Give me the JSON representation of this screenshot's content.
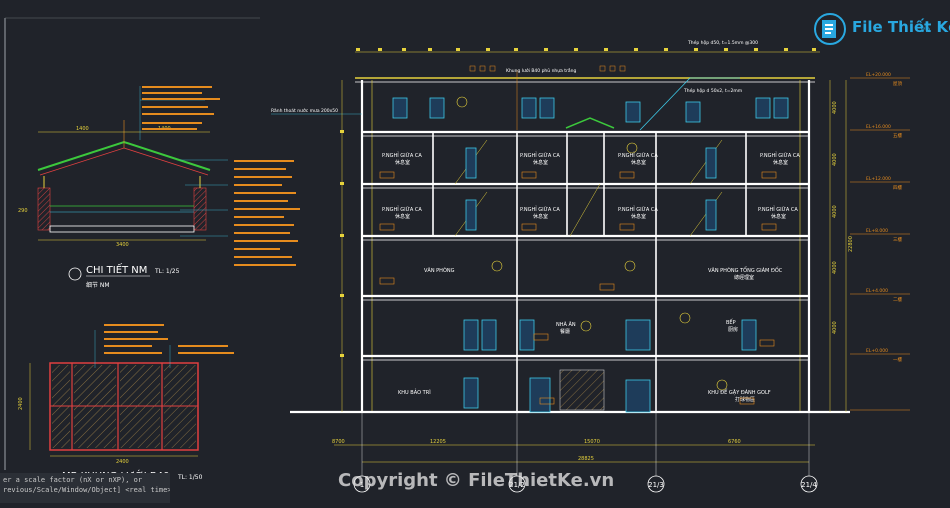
{
  "detail_nm": {
    "title": "CHI TIẾT NM",
    "scale": "TL: 1/25",
    "subtitle_cn": "细节 NM",
    "dim_left": "1400",
    "dim_right": "1400",
    "dim_bottom": "3400",
    "dim_height": "290"
  },
  "khung": {
    "title": "MB KHUNG LƯỚI B40",
    "scale": "TL: 1/50",
    "dim_width": "2400",
    "dim_height": "2400"
  },
  "section": {
    "rooms": [
      {
        "id": "r1",
        "label": "P.NGHỈ GIỮA CA",
        "cn": "休息室"
      },
      {
        "id": "r2",
        "label": "P.NGHỈ GIỮA CA",
        "cn": "休息室"
      },
      {
        "id": "r3",
        "label": "P.NGHỈ GIỮA CA",
        "cn": "休息室"
      },
      {
        "id": "r4",
        "label": "P.NGHỈ GIỮA CA",
        "cn": "休息室"
      },
      {
        "id": "r5",
        "label": "P.NGHỈ GIỮA CA",
        "cn": "休息室"
      },
      {
        "id": "r6",
        "label": "P.NGHỈ GIỮA CA",
        "cn": "休息室"
      },
      {
        "id": "r7",
        "label": "P.NGHỈ GIỮA CA",
        "cn": "休息室"
      },
      {
        "id": "r8",
        "label": "P.NGHỈ GIỮA CA",
        "cn": "休息室"
      },
      {
        "id": "vp",
        "label": "VĂN PHÒNG",
        "cn": ""
      },
      {
        "id": "vptgd",
        "label": "VĂN PHÒNG TỔNG GIÁM ĐỐC",
        "cn": "總經理室"
      },
      {
        "id": "na",
        "label": "NHÀ ĂN",
        "cn": "餐廳"
      },
      {
        "id": "bep",
        "label": "BẾP",
        "cn": "厨房"
      },
      {
        "id": "kbt",
        "label": "KHU BẢO TRÌ",
        "cn": ""
      },
      {
        "id": "golf",
        "label": "KHU ĐỂ GẬY ĐÁNH GOLF",
        "cn": "打球物區"
      }
    ],
    "level_labels": [
      "EL+20.000",
      "EL+16.000",
      "EL+12.000",
      "EL+8.000",
      "EL+4.000",
      "EL+0.000"
    ],
    "floor_labels": [
      "屋頂",
      "五樓",
      "四樓",
      "三樓",
      "二樓",
      "一樓"
    ],
    "dims_right": [
      "4000",
      "4000",
      "4000",
      "4000",
      "4000",
      "22800"
    ],
    "dims_bottom": [
      "8700",
      "12205",
      "15070",
      "6760"
    ],
    "total_bottom": "28825",
    "axis_labels": [
      "1",
      "21/2",
      "21/3",
      "21/4"
    ],
    "annotations": [
      "Thép hộp d50, t=1.5mm @300",
      "Khung lưới B40 phủ nhựa trắng",
      "Rãnh thoát nước mưa 200x50",
      "Thép hộp d 50x2, t=2mm"
    ]
  },
  "command_line": [
    "er a scale factor (nX or nXP), or",
    "revious/Scale/Window/Object] <real time>:"
  ],
  "watermark": "Copyright © FileThietKe.vn",
  "logo": {
    "name": "File Thiết Kế",
    "domain": ".vn"
  },
  "colors": {
    "bg": "#20232a",
    "wall": "#ffffff",
    "yellow": "#e6d23c",
    "cyan": "#3cc8e6",
    "red": "#e04040",
    "green": "#3cc83c",
    "orange": "#e68c1e",
    "magenta": "#d04cd0",
    "blue": "#3c6ee6"
  }
}
